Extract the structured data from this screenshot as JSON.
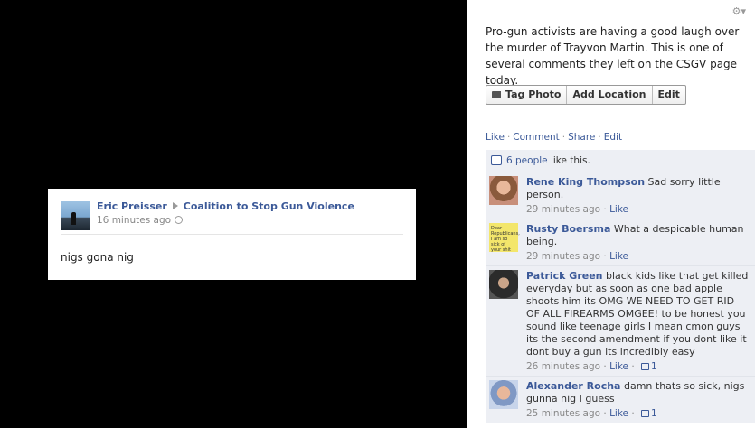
{
  "photo": {
    "author": "Eric Preisser",
    "target": "Coalition to Stop Gun Violence",
    "time": "16 minutes ago",
    "message": "nigs gona nig"
  },
  "side": {
    "gear_icon": "gear-icon",
    "caption": "Pro-gun activists are having a good laugh over the murder of Trayvon Martin. This is one of several comments they left on the CSGV page today.",
    "buttons": {
      "tag_photo": "Tag Photo",
      "add_location": "Add Location",
      "edit": "Edit"
    },
    "actions": {
      "like": "Like",
      "comment": "Comment",
      "share": "Share",
      "edit": "Edit"
    },
    "likes": {
      "count_link": "6 people",
      "suffix": "like this."
    },
    "comments": [
      {
        "author": "Rene King Thompson",
        "text": "Sad sorry little person.",
        "time": "29 minutes ago",
        "like": "Like",
        "likes": ""
      },
      {
        "author": "Rusty Boersma",
        "text": "What a despicable human being.",
        "time": "29 minutes ago",
        "like": "Like",
        "likes": ""
      },
      {
        "author": "Patrick Green",
        "text": "black kids like that get killed everyday but as soon as one bad apple shoots him its OMG WE NEED TO GET RID OF ALL FIREARMS OMGEE! to be honest you sound like teenage girls I mean cmon guys its the second amendment if you dont like it dont buy a gun its incredibly easy",
        "time": "26 minutes ago",
        "like": "Like",
        "likes": "1"
      },
      {
        "author": "Alexander Rocha",
        "text": "damn thats so sick, nigs gunna nig I guess",
        "time": "25 minutes ago",
        "like": "Like",
        "likes": "1"
      }
    ],
    "avatar2_text": "Dear Republicans, I am so sick of your shit"
  }
}
